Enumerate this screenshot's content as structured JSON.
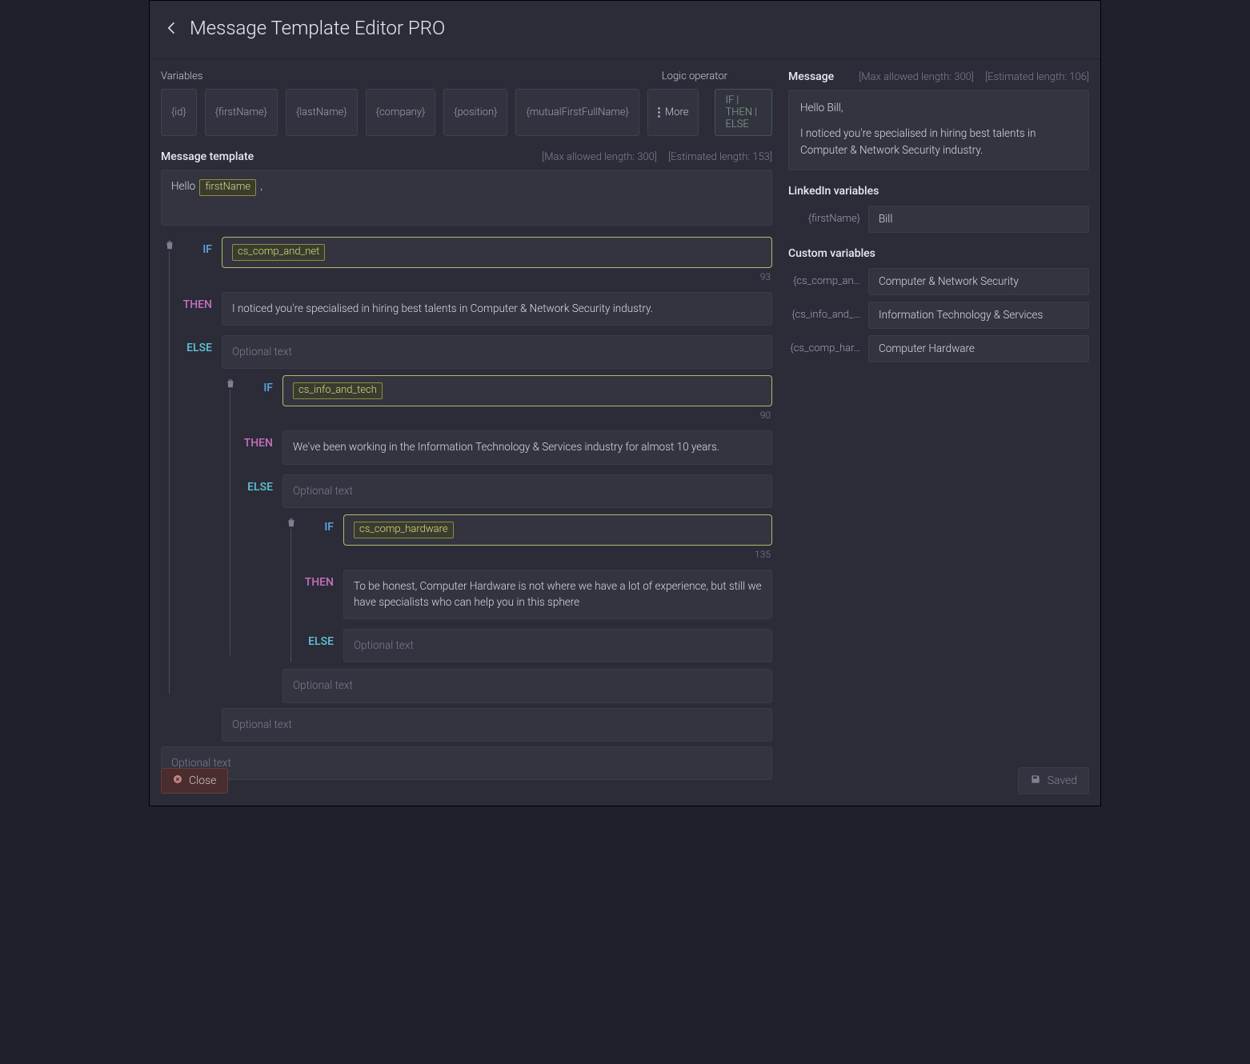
{
  "header": {
    "title": "Message Template Editor PRO"
  },
  "labels": {
    "variables": "Variables",
    "logic_operator": "Logic operator",
    "message_template": "Message template",
    "message": "Message",
    "linkedin_vars": "LinkedIn variables",
    "custom_vars": "Custom variables",
    "max_len_300": "[Max allowed length: 300]",
    "est_len_153": "[Estimated length: 153]",
    "est_len_106": "[Estimated length: 106]"
  },
  "variables": [
    "{id}",
    "{firstName}",
    "{lastName}",
    "{company}",
    "{position}",
    "{mutualFirstFullName}"
  ],
  "more_label": "More",
  "logic_chip": "IF | THEN | ELSE",
  "template": {
    "hello_prefix": "Hello ",
    "hello_token": "firstName",
    "hello_suffix": " ,"
  },
  "tree": {
    "if1": "cs_comp_and_net",
    "if1_count": "93",
    "then1": "I noticed you're specialised in hiring best talents in Computer & Network Security industry.",
    "else1_placeholder": "Optional text",
    "if2": "cs_info_and_tech",
    "if2_count": "90",
    "then2": "We've been working in the Information Technology & Services industry for almost 10  years.",
    "else2_placeholder": "Optional text",
    "if3": "cs_comp_hardware",
    "if3_count": "135",
    "then3": "To be honest, Computer Hardware is not where we have a lot of experience, but still we have specialists who can help you in this sphere",
    "else3_placeholder": "Optional text",
    "tail3_placeholder": "Optional text",
    "tail2_placeholder": "Optional text",
    "tail1_placeholder": "Optional text"
  },
  "preview": {
    "line1": "Hello Bill,",
    "line2": "I noticed you're specialised in hiring best talents in Computer & Network Security industry."
  },
  "linkedin_vars": [
    {
      "key": "{firstName}",
      "value": "Bill"
    }
  ],
  "custom_vars": [
    {
      "key": "{cs_comp_an…",
      "value": "Computer & Network Security"
    },
    {
      "key": "{cs_info_and_…",
      "value": "Information Technology & Services"
    },
    {
      "key": "{cs_comp_har…",
      "value": "Computer Hardware"
    }
  ],
  "footer": {
    "close": "Close",
    "saved": "Saved"
  },
  "kw": {
    "if": "IF",
    "then": "THEN",
    "else": "ELSE"
  }
}
